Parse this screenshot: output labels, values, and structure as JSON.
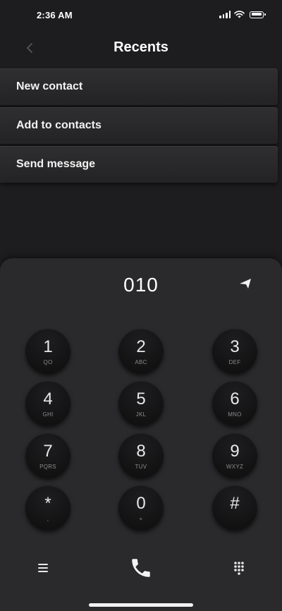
{
  "status_bar": {
    "time": "2:36 AM"
  },
  "header": {
    "title": "Recents",
    "back_icon": "chevron-left-icon"
  },
  "menu": {
    "items": [
      {
        "label": "New contact"
      },
      {
        "label": "Add to contacts"
      },
      {
        "label": "Send message"
      }
    ]
  },
  "dialer": {
    "number": "010",
    "send_icon": "send-arrow-icon",
    "keys": [
      {
        "digit": "1",
        "letters": "QO"
      },
      {
        "digit": "2",
        "letters": "ABC"
      },
      {
        "digit": "3",
        "letters": "DEF"
      },
      {
        "digit": "4",
        "letters": "GHI"
      },
      {
        "digit": "5",
        "letters": "JKL"
      },
      {
        "digit": "6",
        "letters": "MNO"
      },
      {
        "digit": "7",
        "letters": "PQRS"
      },
      {
        "digit": "8",
        "letters": "TUV"
      },
      {
        "digit": "9",
        "letters": "WXYZ"
      },
      {
        "digit": "*",
        "letters": ","
      },
      {
        "digit": "0",
        "letters": "+"
      },
      {
        "digit": "#",
        "letters": ""
      }
    ]
  },
  "bottom_bar": {
    "menu_icon": "hamburger-menu-icon",
    "call_icon": "phone-icon",
    "dialpad_icon": "dialpad-grid-icon"
  },
  "colors": {
    "background": "#1d1d1f",
    "panel": "#2a2a2c",
    "text": "#ffffff",
    "subtext": "#8a8a8c"
  }
}
